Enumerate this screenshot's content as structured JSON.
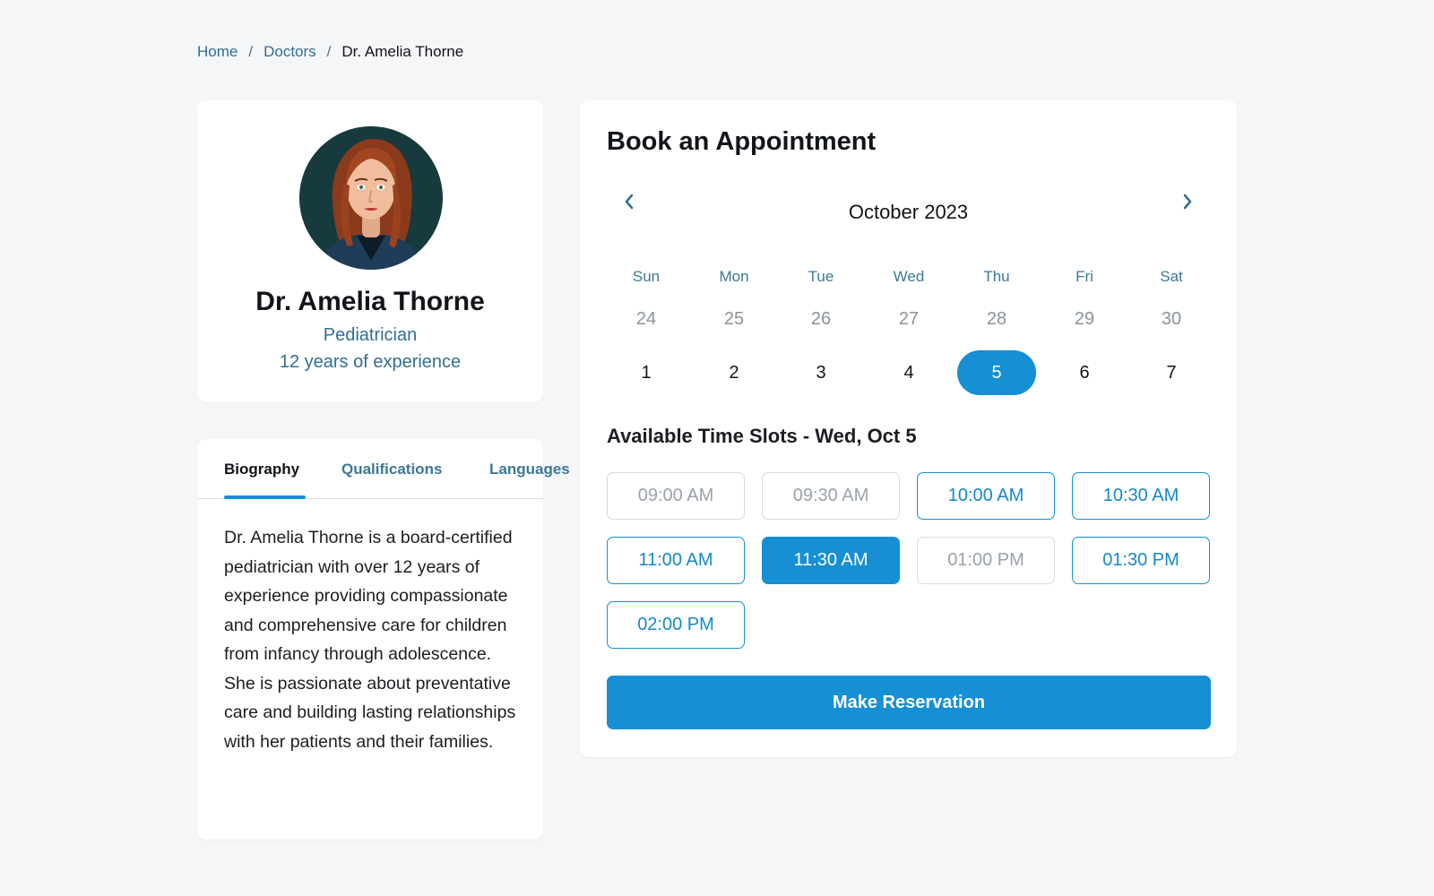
{
  "breadcrumb": {
    "home": "Home",
    "doctors": "Doctors",
    "current": "Dr. Amelia Thorne",
    "separator": "/"
  },
  "doctor": {
    "name": "Dr. Amelia Thorne",
    "specialty": "Pediatrician",
    "experience": "12 years of experience",
    "avatar_icon": "doctor-portrait"
  },
  "tabs": [
    {
      "label": "Biography",
      "active": true
    },
    {
      "label": "Qualifications",
      "active": false
    },
    {
      "label": "Languages",
      "active": false
    }
  ],
  "biography": "Dr. Amelia Thorne is a board-certified pediatrician with over 12 years of experience providing compassionate and comprehensive care for children from infancy through adolescence. She is passionate about preventative care and building lasting relationships with her patients and their families.",
  "booking": {
    "title": "Book an Appointment",
    "month": "October 2023",
    "prev_icon": "chevron-left-icon",
    "next_icon": "chevron-right-icon",
    "weekdays": [
      "Sun",
      "Mon",
      "Tue",
      "Wed",
      "Thu",
      "Fri",
      "Sat"
    ],
    "week1": [
      "24",
      "25",
      "26",
      "27",
      "28",
      "29",
      "30"
    ],
    "week2": [
      "1",
      "2",
      "3",
      "4",
      "5",
      "6",
      "7"
    ],
    "selected_day": "5",
    "slots_title": "Available Time Slots - Wed, Oct 5",
    "slots": [
      {
        "time": "09:00 AM",
        "state": "unavailable"
      },
      {
        "time": "09:30 AM",
        "state": "unavailable"
      },
      {
        "time": "10:00 AM",
        "state": "available"
      },
      {
        "time": "10:30 AM",
        "state": "available"
      },
      {
        "time": "11:00 AM",
        "state": "available"
      },
      {
        "time": "11:30 AM",
        "state": "selected"
      },
      {
        "time": "01:00 PM",
        "state": "unavailable"
      },
      {
        "time": "01:30 PM",
        "state": "available"
      },
      {
        "time": "02:00 PM",
        "state": "available"
      }
    ],
    "reserve_label": "Make Reservation"
  },
  "colors": {
    "accent": "#168fd4",
    "link": "#2f6f93",
    "background": "#f5f6f8"
  }
}
